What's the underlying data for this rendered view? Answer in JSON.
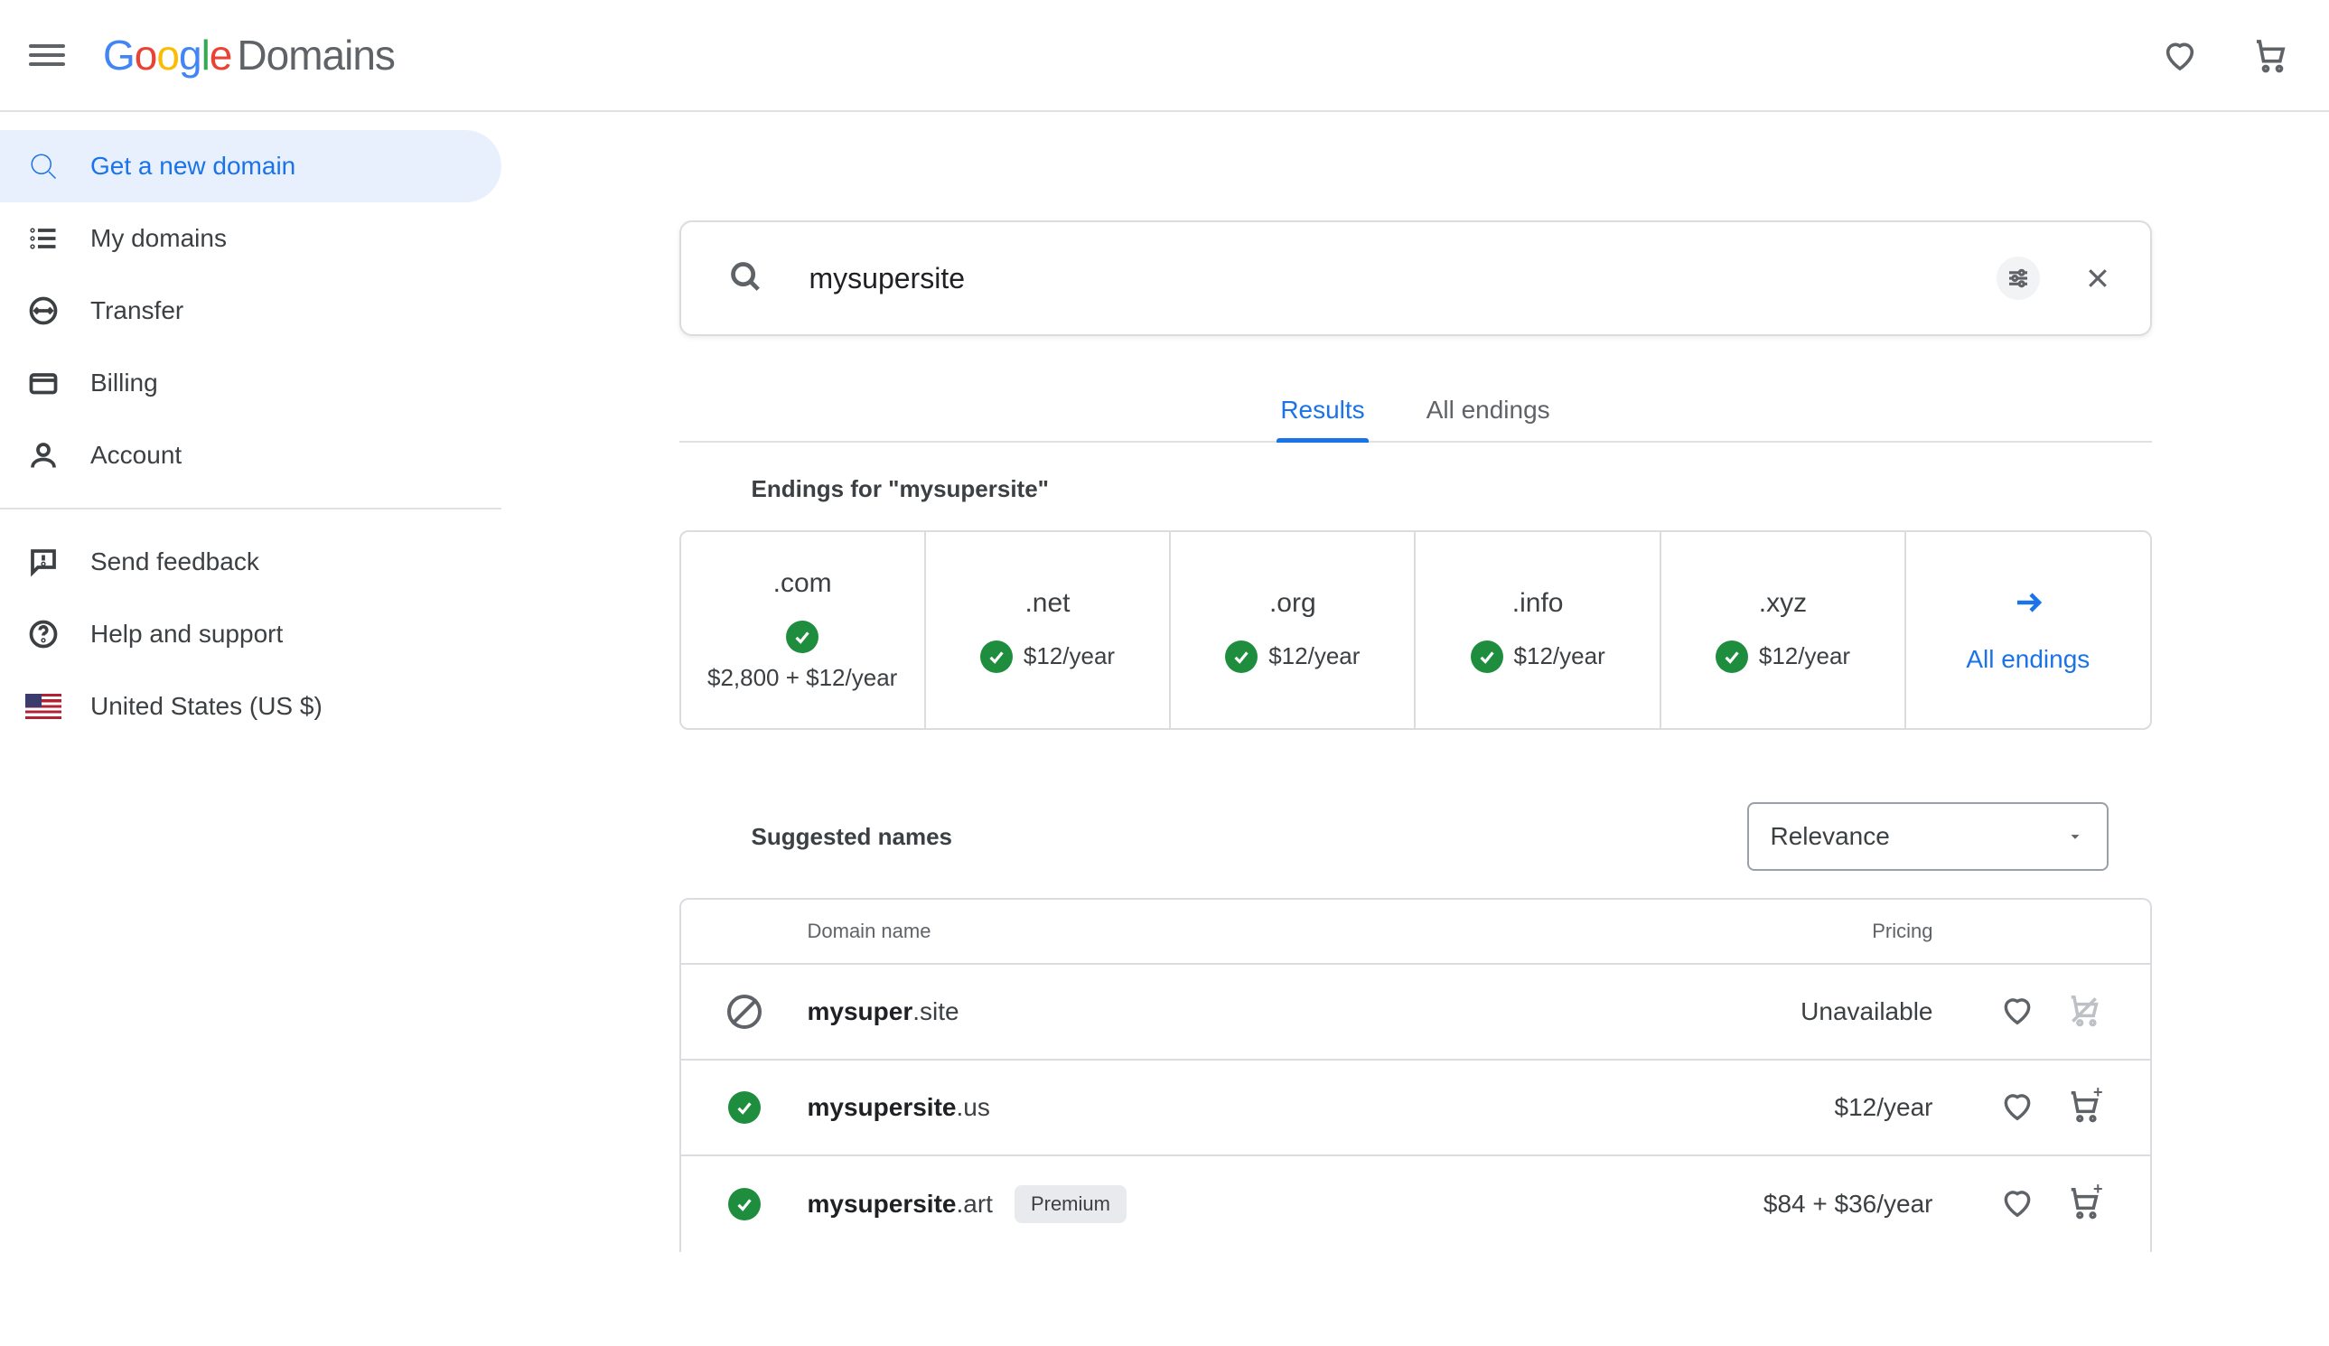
{
  "header": {
    "product_name": "Domains"
  },
  "sidebar": {
    "items": [
      {
        "label": "Get a new domain"
      },
      {
        "label": "My domains"
      },
      {
        "label": "Transfer"
      },
      {
        "label": "Billing"
      },
      {
        "label": "Account"
      }
    ],
    "secondary": [
      {
        "label": "Send feedback"
      },
      {
        "label": "Help and support"
      },
      {
        "label": "United States (US $)"
      }
    ]
  },
  "search": {
    "value": "mysupersite"
  },
  "tabs": {
    "results": "Results",
    "all_endings": "All endings"
  },
  "endings_section": {
    "title": "Endings for \"mysupersite\"",
    "cells": [
      {
        "tld": ".com",
        "price": "$2,800 + $12/year",
        "premium": true
      },
      {
        "tld": ".net",
        "price": "$12/year",
        "premium": false
      },
      {
        "tld": ".org",
        "price": "$12/year",
        "premium": false
      },
      {
        "tld": ".info",
        "price": "$12/year",
        "premium": false
      },
      {
        "tld": ".xyz",
        "price": "$12/year",
        "premium": false
      }
    ],
    "all_endings_label": "All endings"
  },
  "suggested": {
    "title": "Suggested names",
    "sort_label": "Relevance"
  },
  "results": {
    "col_domain": "Domain name",
    "col_pricing": "Pricing",
    "premium_badge": "Premium",
    "unavailable_label": "Unavailable",
    "rows": [
      {
        "base": "mysuper",
        "ext": ".site",
        "status": "unavailable",
        "price": "Unavailable",
        "premium": false
      },
      {
        "base": "mysupersite",
        "ext": ".us",
        "status": "available",
        "price": "$12/year",
        "premium": false
      },
      {
        "base": "mysupersite",
        "ext": ".art",
        "status": "available",
        "price": "$84 + $36/year",
        "premium": true
      }
    ]
  }
}
